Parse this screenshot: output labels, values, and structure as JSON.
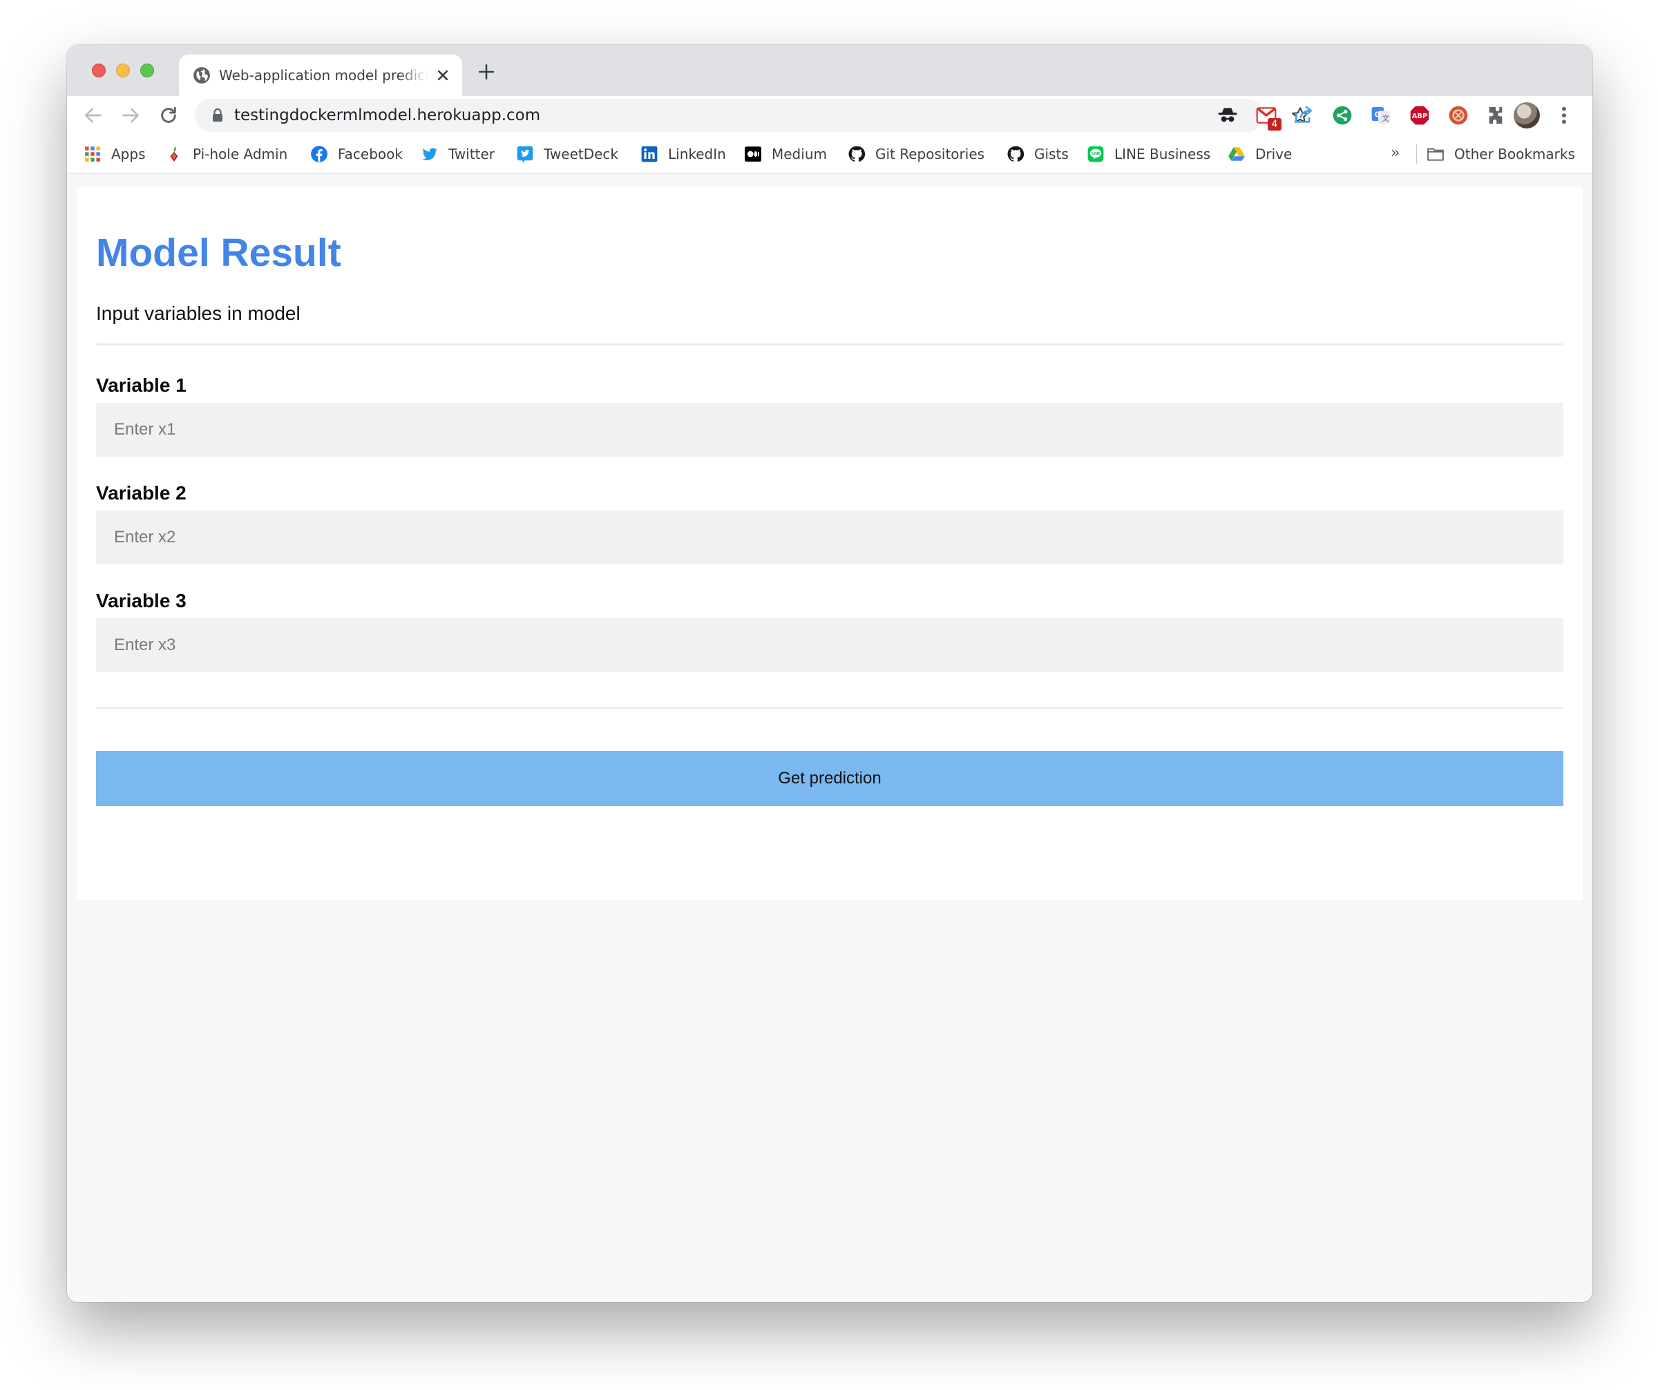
{
  "browser": {
    "tab": {
      "title": "Web-application model prediction"
    },
    "omnibox": {
      "url": "testingdockermlmodel.herokuapp.com"
    },
    "extensions": {
      "gmail_badge": "4"
    },
    "bookmarks": [
      {
        "label": "Apps",
        "icon": "apps-grid-icon"
      },
      {
        "label": "Pi-hole Admin",
        "icon": "pihole-icon"
      },
      {
        "label": "Facebook",
        "icon": "facebook-icon"
      },
      {
        "label": "Twitter",
        "icon": "twitter-icon"
      },
      {
        "label": "TweetDeck",
        "icon": "tweetdeck-icon"
      },
      {
        "label": "LinkedIn",
        "icon": "linkedin-icon"
      },
      {
        "label": "Medium",
        "icon": "medium-icon"
      },
      {
        "label": "Git Repositories",
        "icon": "github-icon"
      },
      {
        "label": "Gists",
        "icon": "github-icon"
      },
      {
        "label": "LINE Business",
        "icon": "line-icon"
      },
      {
        "label": "Drive",
        "icon": "drive-icon"
      }
    ],
    "more_bookmarks": "»",
    "other_bookmarks": "Other Bookmarks"
  },
  "page": {
    "title": "Model Result",
    "subtitle": "Input variables in model",
    "fields": [
      {
        "label": "Variable 1",
        "placeholder": "Enter x1"
      },
      {
        "label": "Variable 2",
        "placeholder": "Enter x2"
      },
      {
        "label": "Variable 3",
        "placeholder": "Enter x3"
      }
    ],
    "submit_label": "Get prediction"
  },
  "colors": {
    "title": "#4285e6",
    "button": "#7ab8ef",
    "input_bg": "#f1f1f1",
    "page_bg": "#f6f7f9"
  }
}
